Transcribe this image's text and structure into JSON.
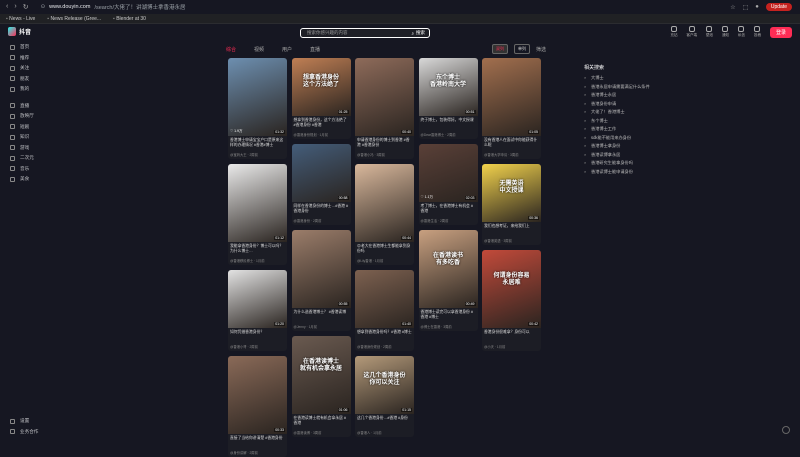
{
  "browser": {
    "url_host": "www.douyin.com",
    "url_path": "/search/大佬了！讲湖博士拿香港永居",
    "bookmarks": [
      "News - Live",
      "News Release (Gree...",
      "Blender at 30"
    ],
    "update_label": "Update"
  },
  "app": {
    "logo_text": "抖音",
    "search_placeholder": "搜索你感兴趣的内容",
    "search_button": "搜索",
    "top_actions": [
      "充钻",
      "客户端",
      "壁纸",
      "通知",
      "私信",
      "投稿"
    ],
    "login_label": "登录"
  },
  "sidebar": {
    "items": [
      "首页",
      "推荐",
      "关注",
      "朋友",
      "我的",
      "直播",
      "放映厅",
      "短剧",
      "知识",
      "游戏",
      "二次元",
      "音乐",
      "美食"
    ],
    "bottom_items": [
      "设置",
      "业务合作"
    ]
  },
  "filter": {
    "tabs": [
      "综合",
      "视频",
      "用户",
      "直播"
    ],
    "active_tab": "综合",
    "view_chips": [
      "双列",
      "单列"
    ],
    "filter_label": "筛选"
  },
  "cards": [
    {
      "caption": "香港博士申请宝宝户口是原来这样的办理情况 #香港#博士",
      "meta": "@宝妈大王 · 2周前",
      "dur": "01:32",
      "likes": "1.9万",
      "overlay": ""
    },
    {
      "caption": "想拿到香港身份，这个方法绝了 #香港身份 #香港",
      "meta": "@香港身份规划 · 1月前",
      "dur": "01:25",
      "likes": "",
      "overlay": "想拿香港身份\n这个方法绝了"
    },
    {
      "caption": "申请香港身份的博士到香港 #香港 #香港身份",
      "meta": "@香港小冯 · 3周前",
      "dur": "00:40",
      "likes": "",
      "overlay": ""
    },
    {
      "caption": "终于博士，包装得好。中文授课",
      "meta": "@Dear香港博士 · 2周前",
      "dur": "00:51",
      "likes": "",
      "overlay": "东个博士\n香港岭南大学"
    },
    {
      "caption": "没有香港人在面试中你能获得什么呢",
      "meta": "@香港大学申请 · 3周前",
      "dur": "01:05",
      "likes": "",
      "overlay": ""
    },
    {
      "caption": "我能拿香港身份？博士可以吗？ 为什么博士…",
      "meta": "@香港移民博士 · 1月前",
      "dur": "01:12",
      "likes": "",
      "overlay": ""
    },
    {
      "caption": "同样在香港身份的博士…#香港 #香港身份",
      "meta": "@香港身份 · 2周前",
      "dur": "00:58",
      "likes": "",
      "overlay": ""
    },
    {
      "caption": "😊老大在香港博士生都能拿到身份吗",
      "meta": "@Lily香港 · 1月前",
      "dur": "00:44",
      "likes": "",
      "overlay": ""
    },
    {
      "caption": "考了博士，在香港博士有机会 #香港",
      "meta": "@香港生活 · 2周前",
      "dur": "02:03",
      "likes": "1.1万",
      "overlay": ""
    },
    {
      "caption": "我们也想考证，来给我们上",
      "meta": "@香港英语 · 3周前",
      "dur": "00:36",
      "likes": "",
      "overlay": "无需英语\n中文授课"
    },
    {
      "caption": "如何凭借香港身份？",
      "meta": "@香港小哥 · 2周前",
      "dur": "01:20",
      "likes": "",
      "overlay": ""
    },
    {
      "caption": "为什么选香港博士？ #香港读博",
      "meta": "@Jenny · 1月前",
      "dur": "00:55",
      "likes": "",
      "overlay": ""
    },
    {
      "caption": "想拿到香港身份吗？#香港 #博士",
      "meta": "@香港身份规划 · 2周前",
      "dur": "01:40",
      "likes": "",
      "overlay": ""
    },
    {
      "caption": "香港博士读完可以拿香港身份 #香港 #博士",
      "meta": "@博士在香港 · 3周前",
      "dur": "00:49",
      "likes": "",
      "overlay": "在香港读书\n有多吃香"
    },
    {
      "caption": "这几个香港身份…#香港 #身份",
      "meta": "@香港人 · 1月前",
      "dur": "01:15",
      "likes": "",
      "overlay": "这几个香港身份\n你可以关注"
    },
    {
      "caption": "直接了当给你讲清楚 #香港身份",
      "meta": "@身份讲解 · 2周前",
      "dur": "00:33",
      "likes": "",
      "overlay": ""
    },
    {
      "caption": "在香港读博士就有机会拿永居 #香港",
      "meta": "@香港读博 · 3周前",
      "dur": "01:06",
      "likes": "",
      "overlay": "在香港读博士\n就有机会拿永居"
    },
    {
      "caption": "香港身份很难拿？身份可以",
      "meta": "@小天 · 1月前",
      "dur": "00:42",
      "likes": "",
      "overlay": "何谓身份容易\n永居难"
    }
  ],
  "related": {
    "title": "相关搜索",
    "items": [
      "大博士",
      "香港永居申请需要满足什么条件",
      "香港博士永居",
      "香港身份申请",
      "大佬了！香港博士",
      "东个博士",
      "香港博士工作",
      "sdk能不能用来办身份",
      "香港博士拿身份",
      "香港读博拿永居",
      "香港研究生能拿身份吗",
      "香港读博士能申请身份"
    ]
  }
}
